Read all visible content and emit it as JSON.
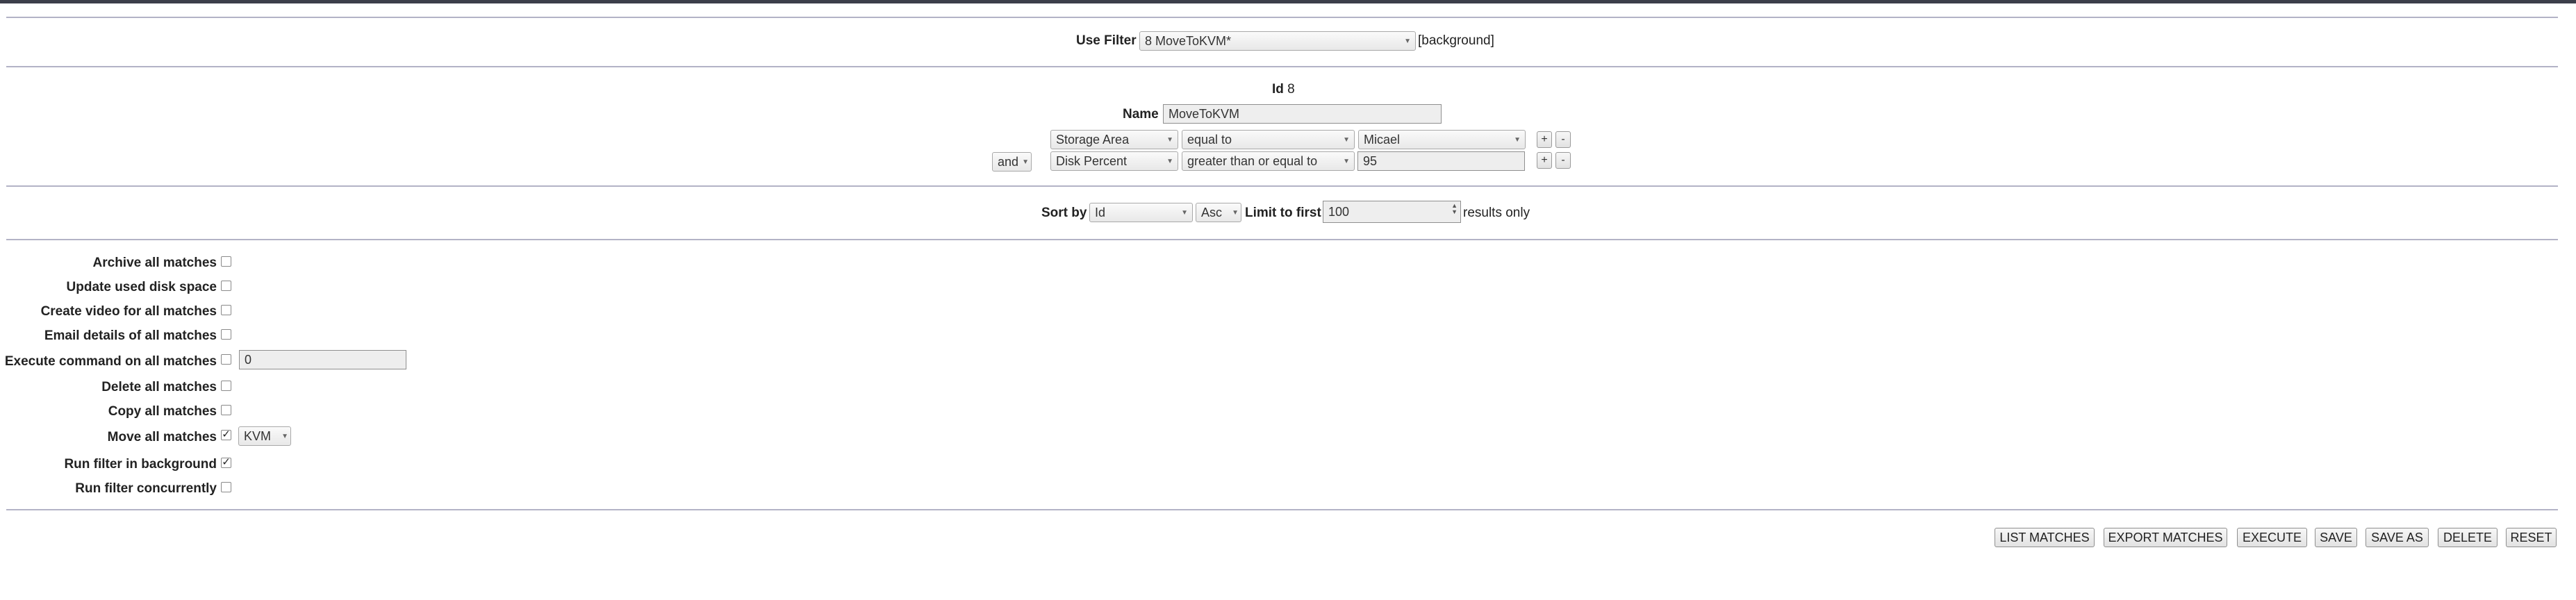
{
  "filter_select": {
    "label": "Use Filter",
    "value": "8 MoveToKVM*",
    "suffix": "[background]"
  },
  "filter_info": {
    "id_label": "Id",
    "id_value": "8",
    "name_label": "Name",
    "name_value": "MoveToKVM"
  },
  "terms": [
    {
      "conjunction": "",
      "attribute": "Storage Area",
      "operator": "equal to",
      "value": "Micael",
      "value_type": "select",
      "add": "+",
      "remove": "-"
    },
    {
      "conjunction": "and",
      "attribute": "Disk Percent",
      "operator": "greater than or equal to",
      "value": "95",
      "value_type": "input",
      "add": "+",
      "remove": "-"
    }
  ],
  "sort": {
    "label": "Sort by",
    "field": "Id",
    "order": "Asc",
    "limit_label": "Limit to first",
    "limit_value": "100",
    "limit_suffix": "results only"
  },
  "actions": {
    "archive": {
      "label": "Archive all matches",
      "checked": false
    },
    "update_disk": {
      "label": "Update used disk space",
      "checked": false
    },
    "create_video": {
      "label": "Create video for all matches",
      "checked": false
    },
    "email": {
      "label": "Email details of all matches",
      "checked": false
    },
    "execute_cmd": {
      "label": "Execute command on all matches",
      "checked": false,
      "value": "0"
    },
    "delete": {
      "label": "Delete all matches",
      "checked": false
    },
    "copy": {
      "label": "Copy all matches",
      "checked": false
    },
    "move": {
      "label": "Move all matches",
      "checked": true,
      "target": "KVM"
    },
    "background": {
      "label": "Run filter in background",
      "checked": true
    },
    "concurrent": {
      "label": "Run filter concurrently",
      "checked": false
    }
  },
  "buttons": {
    "list_matches": "LIST MATCHES",
    "export_matches": "EXPORT MATCHES",
    "execute": "EXECUTE",
    "save": "SAVE",
    "save_as": "SAVE AS",
    "delete": "DELETE",
    "reset": "RESET"
  },
  "icons": {
    "dropdown": "chevron-down-icon",
    "check": "checkmark-icon",
    "spinner": "spinner-arrows-icon"
  }
}
